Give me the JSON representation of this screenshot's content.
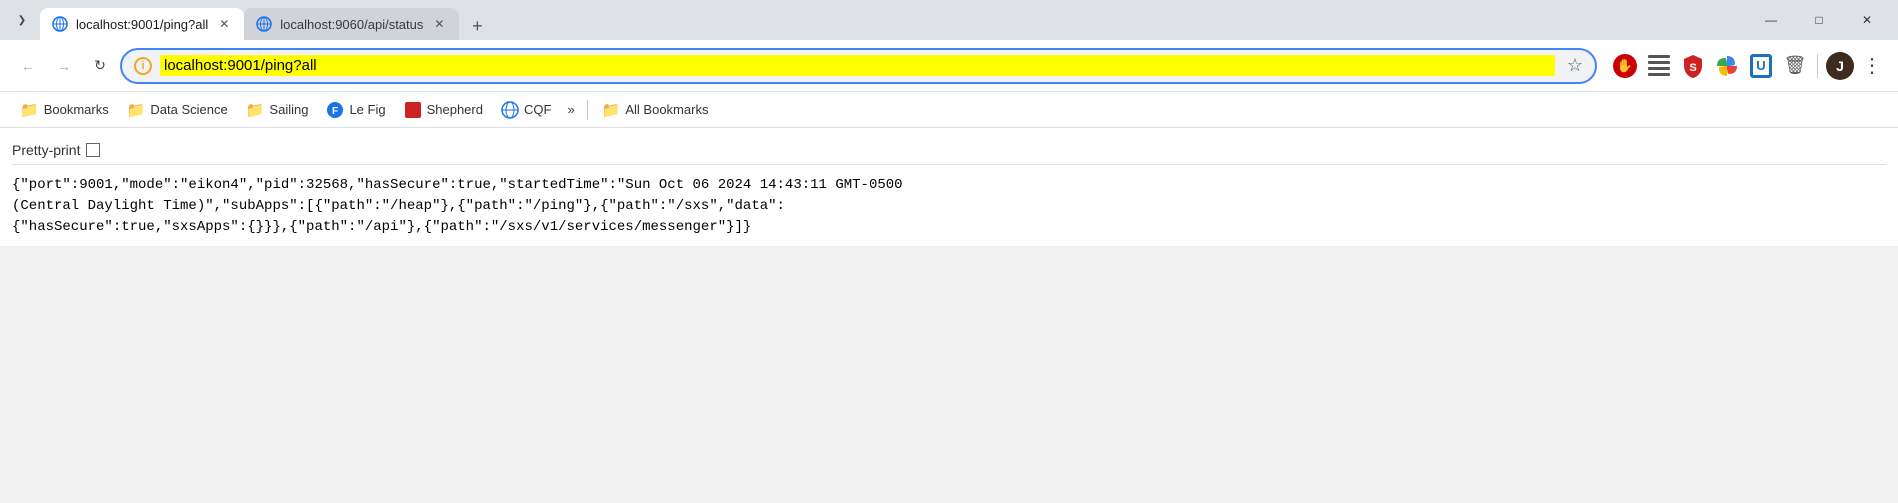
{
  "titleBar": {
    "expandBtn": "❯",
    "tabs": [
      {
        "id": "tab1",
        "title": "localhost:9001/ping?all",
        "active": true,
        "faviconColor": "#1a73e8"
      },
      {
        "id": "tab2",
        "title": "localhost:9060/api/status",
        "active": false,
        "faviconColor": "#1a73e8"
      }
    ],
    "newTabLabel": "+",
    "windowControls": {
      "minimize": "—",
      "maximize": "□",
      "close": "✕"
    }
  },
  "navBar": {
    "backBtn": "←",
    "forwardBtn": "→",
    "reloadBtn": "↻",
    "addressBar": {
      "url": "localhost:9001/ping?all",
      "infoIconLabel": "i",
      "starIcon": "☆"
    },
    "toolbarIcons": {
      "profileLabel": "J",
      "moreLabel": "⋮"
    }
  },
  "bookmarksBar": {
    "items": [
      {
        "id": "bm1",
        "label": "Bookmarks",
        "type": "folder"
      },
      {
        "id": "bm2",
        "label": "Data Science",
        "type": "folder"
      },
      {
        "id": "bm3",
        "label": "Sailing",
        "type": "folder"
      },
      {
        "id": "bm4",
        "label": "Le Fig",
        "type": "site",
        "iconColor": "#1a73e8"
      },
      {
        "id": "bm5",
        "label": "Shepherd",
        "type": "site",
        "iconColor": "#cc0000"
      },
      {
        "id": "bm6",
        "label": "CQF",
        "type": "site",
        "iconColor": "#1a73e8"
      }
    ],
    "overflow": "»",
    "allBookmarks": "All Bookmarks"
  },
  "content": {
    "prettyPrint": {
      "label": "Pretty-print",
      "checked": false
    },
    "jsonText": "{\"port\":9001,\"mode\":\"eikon4\",\"pid\":32568,\"hasSecure\":true,\"startedTime\":\"Sun Oct 06 2024 14:43:11 GMT-0500\n(Central Daylight Time)\",\"subApps\":[{\"path\":\"/heap\"},{\"path\":\"/ping\"},{\"path\":\"/sxs\",\"data\":\n{\"hasSecure\":true,\"sxsApps\":{}}},{\"path\":\"/api\"},{\"path\":\"/sxs/v1/services/messenger\"}]}"
  }
}
